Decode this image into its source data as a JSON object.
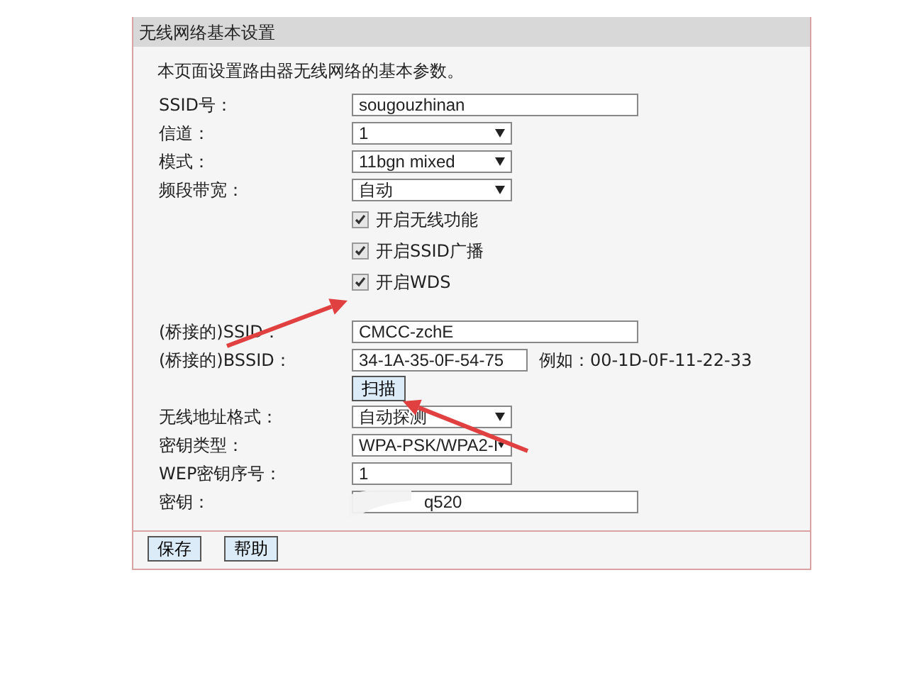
{
  "panel": {
    "title": "无线网络基本设置",
    "description": "本页面设置路由器无线网络的基本参数。"
  },
  "basic": [
    {
      "kind": "text",
      "label": "SSID号：",
      "value": "sougouzhinan"
    },
    {
      "kind": "select",
      "label": "信道：",
      "value": "1"
    },
    {
      "kind": "select",
      "label": "模式：",
      "value": "11bgn mixed"
    },
    {
      "kind": "select",
      "label": "频段带宽：",
      "value": "自动"
    },
    {
      "kind": "checkbox",
      "label": "开启无线功能",
      "checked": true
    },
    {
      "kind": "checkbox",
      "label": "开启SSID广播",
      "checked": true
    },
    {
      "kind": "checkbox",
      "label": "开启WDS",
      "checked": true
    }
  ],
  "wds": [
    {
      "kind": "text",
      "label": "(桥接的)SSID：",
      "value": "CMCC-zchE"
    },
    {
      "kind": "hinted",
      "label": "(桥接的)BSSID：",
      "value": "34-1A-35-0F-54-75",
      "hint": "例如：00-1D-0F-11-22-33"
    },
    {
      "kind": "button",
      "label": "扫描"
    },
    {
      "kind": "select",
      "label": "无线地址格式：",
      "value": "自动探测"
    },
    {
      "kind": "select",
      "label": "密钥类型：",
      "value": "WPA-PSK/WPA2-I"
    },
    {
      "kind": "short",
      "label": "WEP密钥序号：",
      "value": "1"
    },
    {
      "kind": "smudged",
      "label": "密钥：",
      "value": "q520"
    }
  ],
  "buttons": [
    "保存",
    "帮助"
  ]
}
